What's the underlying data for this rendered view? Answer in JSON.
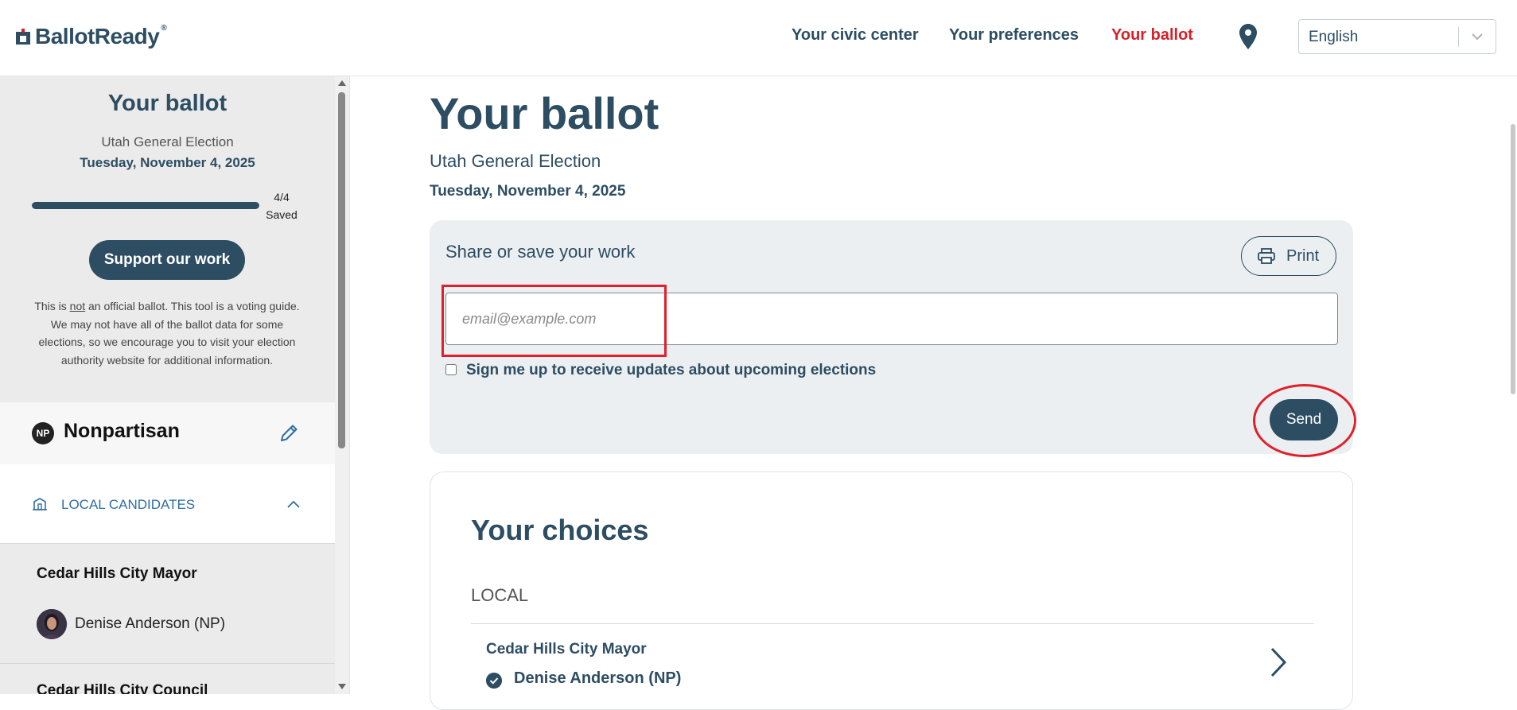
{
  "header": {
    "logo_text": "BallotReady",
    "logo_reg": "®",
    "nav": [
      {
        "label": "Your civic center"
      },
      {
        "label": "Your preferences"
      },
      {
        "label": "Your ballot"
      }
    ],
    "language": "English",
    "active_color": "#d62027",
    "brand_color": "#2c4d62"
  },
  "sidebar": {
    "title": "Your ballot",
    "election": "Utah General Election",
    "date": "Tuesday, November 4, 2025",
    "progress_count": "4/4",
    "progress_label": "Saved",
    "progress_value": 1.0,
    "support_button": "Support our work",
    "disclaimer_1": "This is ",
    "disclaimer_not": "not",
    "disclaimer_2": " an official ballot. This tool is a voting guide. We may not have all of the ballot data for some elections, so we encourage you to visit your election authority website for additional information.",
    "party_badge": "NP",
    "party_name": "Nonpartisan",
    "category": "LOCAL CANDIDATES",
    "race_1": "Cedar Hills City Mayor",
    "candidate_1": "Denise Anderson (NP)",
    "race_2": "Cedar Hills City Council"
  },
  "main": {
    "title": "Your ballot",
    "election": "Utah General Election",
    "date": "Tuesday, November 4, 2025",
    "share": {
      "title": "Share or save your work",
      "print_label": "Print",
      "email_placeholder": "email@example.com",
      "email_value": "",
      "signup_label": "Sign me up to receive updates about upcoming elections",
      "send_label": "Send"
    },
    "choices": {
      "title": "Your choices",
      "section": "LOCAL",
      "race": "Cedar Hills City Mayor",
      "candidate": "Denise Anderson (NP)"
    }
  }
}
